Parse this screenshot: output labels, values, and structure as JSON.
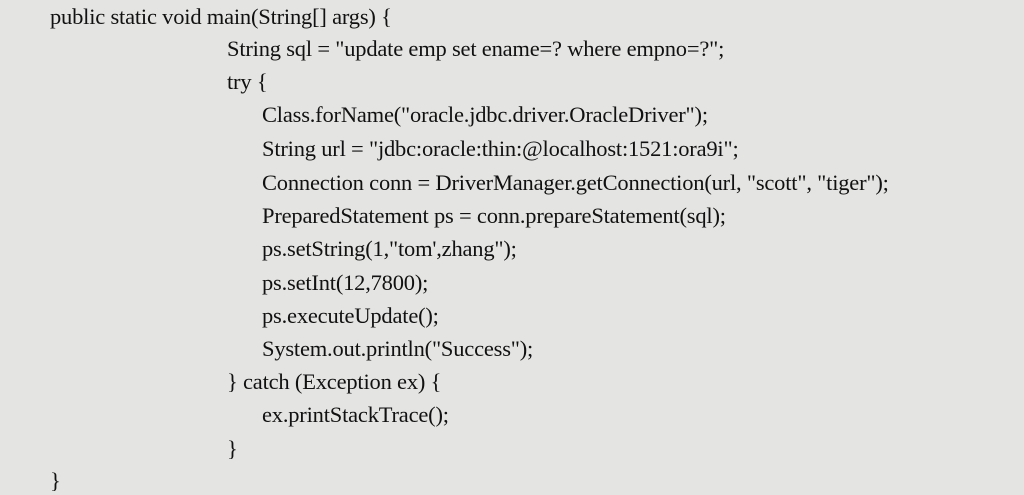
{
  "code": {
    "lines": [
      "public static void main(String[] args) {",
      "String sql = \"update emp set ename=? where empno=?\";",
      "try {",
      "Class.forName(\"oracle.jdbc.driver.OracleDriver\");",
      "String url = \"jdbc:oracle:thin:@localhost:1521:ora9i\";",
      "Connection conn = DriverManager.getConnection(url, \"scott\", \"tiger\");",
      "PreparedStatement ps = conn.prepareStatement(sql);",
      "ps.setString(1,\"tom',zhang\");",
      "ps.setInt(12,7800);",
      "ps.executeUpdate();",
      "System.out.println(\"Success\");",
      "} catch (Exception ex) {",
      "ex.printStackTrace();",
      "}",
      "}"
    ]
  }
}
